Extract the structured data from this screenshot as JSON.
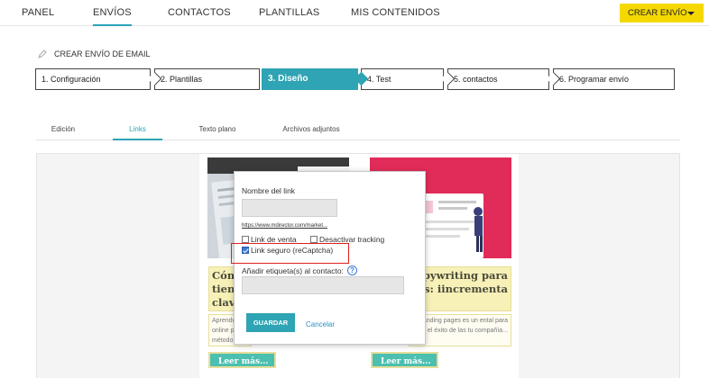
{
  "nav": {
    "items": [
      "PANEL",
      "ENVÍOS",
      "CONTACTOS",
      "PLANTILLAS",
      "MIS CONTENIDOS"
    ],
    "active": "ENVÍOS",
    "cta_label": "CREAR ENVÍO"
  },
  "page": {
    "title": "CREAR ENVÍO DE EMAIL"
  },
  "steps": [
    "1. Configuración",
    "2. Plantillas",
    "3. Diseño",
    "4. Test",
    "5. contactos",
    "6. Programar envío"
  ],
  "active_step": "3. Diseño",
  "subtabs": [
    "Edición",
    "Links",
    "Texto plano",
    "Archivos adjuntos"
  ],
  "active_subtab": "Links",
  "email": {
    "left_headline": "Cómo tiend claves",
    "left_body": "Aprende online pu método p",
    "right_headline": "pywriting para es: iincrementa",
    "right_body": "a landing pages es un ental para el éxito de las tu compañía...",
    "read_more": "Leer más..."
  },
  "modal": {
    "link_name_label": "Nombre del link",
    "url": "https://www.mdirector.com/market...",
    "sale_link_label": "Link de venta",
    "deactivate_tracking_label": "Desactivar tracking",
    "secure_link_label": "Link seguro (reCaptcha)",
    "secure_link_checked": true,
    "tag_label": "Añadir etiqueta(s) al contacto:",
    "help_glyph": "?",
    "save_label": "GUARDAR",
    "cancel_label": "Cancelar"
  },
  "colors": {
    "accent": "#2ea4b4",
    "cta": "#f5d800",
    "highlight": "#e02020",
    "link": "#2a8fc0"
  }
}
